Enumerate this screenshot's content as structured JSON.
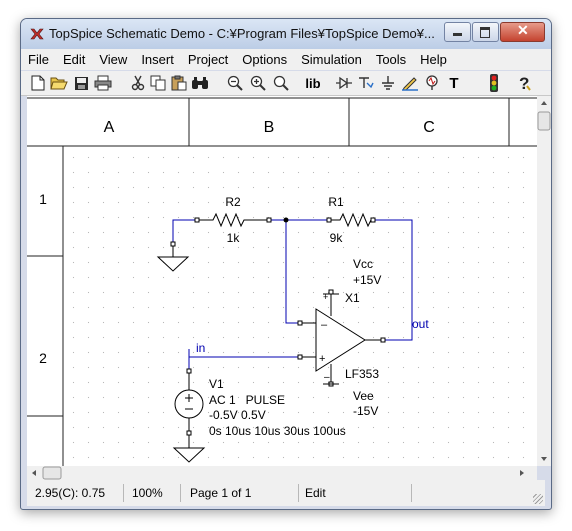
{
  "window": {
    "title": "TopSpice Schematic Demo - C:¥Program Files¥TopSpice Demo¥...",
    "buttons": [
      "minimize-icon",
      "maximize-icon",
      "close-icon"
    ]
  },
  "menu": [
    "File",
    "Edit",
    "View",
    "Insert",
    "Project",
    "Options",
    "Simulation",
    "Tools",
    "Help"
  ],
  "toolbar": {
    "lib_label": "lib",
    "text_tool_label": "T",
    "icons": [
      "new-file-icon",
      "open-folder-icon",
      "save-icon",
      "print-icon",
      "cut-icon",
      "copy-icon",
      "paste-icon",
      "find-icon",
      "zoom-out-icon",
      "zoom-in-icon",
      "zoom-fit-icon",
      "library-icon",
      "diode-icon",
      "transistor-icon",
      "ground-icon",
      "wire-pencil-icon",
      "probe-icon",
      "text-tool-icon",
      "traffic-light-icon",
      "help-icon"
    ]
  },
  "schematic": {
    "columns": [
      "A",
      "B",
      "C"
    ],
    "rows": [
      "1",
      "2"
    ],
    "components": {
      "r2": {
        "name": "R2",
        "value": "1k"
      },
      "r1": {
        "name": "R1",
        "value": "9k"
      },
      "opamp": {
        "name": "X1",
        "model": "LF353"
      },
      "vcc": {
        "name": "Vcc",
        "value": "+15V"
      },
      "vee": {
        "name": "Vee",
        "value": "-15V"
      },
      "v1": {
        "name": "V1",
        "line1": "AC 1   PULSE",
        "line2": "-0.5V 0.5V",
        "line3": "0s 10us 10us 30us 100us"
      }
    },
    "nets": {
      "input": "in",
      "output": "out"
    },
    "pin_marks": {
      "plus": "+",
      "minus": "–"
    }
  },
  "status": {
    "coords": "2.95(C): 0.75",
    "zoom": "100%",
    "page": "Page 1 of 1",
    "mode": "Edit"
  },
  "colors": {
    "wire": "#0000b0",
    "component": "#000000",
    "grid": "#b8b8b8"
  }
}
